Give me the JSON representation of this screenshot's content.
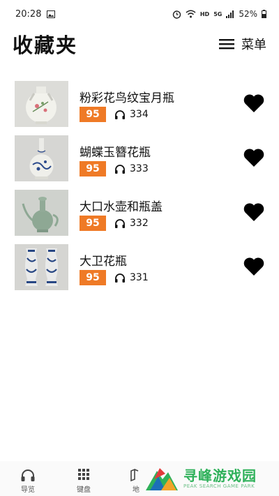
{
  "status_bar": {
    "time": "20:28",
    "network": "HD",
    "signal_label": "5G",
    "battery": "52%"
  },
  "header": {
    "title": "收藏夹",
    "menu_label": "菜单"
  },
  "favorites": [
    {
      "title": "粉彩花鸟纹宝月瓶",
      "score": "95",
      "plays": "334",
      "thumbnail": "moon-flask"
    },
    {
      "title": "蝴蝶玉簪花瓶",
      "score": "95",
      "plays": "333",
      "thumbnail": "blue-white-bottle-vase"
    },
    {
      "title": "大口水壶和瓶盖",
      "score": "95",
      "plays": "332",
      "thumbnail": "celadon-ewer"
    },
    {
      "title": "大卫花瓶",
      "score": "95",
      "plays": "331",
      "thumbnail": "david-vases"
    }
  ],
  "tabbar": {
    "tabs": [
      {
        "label": "导览",
        "icon": "headphones-icon"
      },
      {
        "label": "键盘",
        "icon": "keypad-icon"
      },
      {
        "label": "地",
        "icon": "map-icon"
      }
    ]
  },
  "watermark": {
    "title": "寻峰游戏园",
    "subtitle": "PEAK SEARCH GAME PARK"
  },
  "colors": {
    "score_badge": "#ef7a26",
    "watermark_green": "#2fb15a"
  }
}
